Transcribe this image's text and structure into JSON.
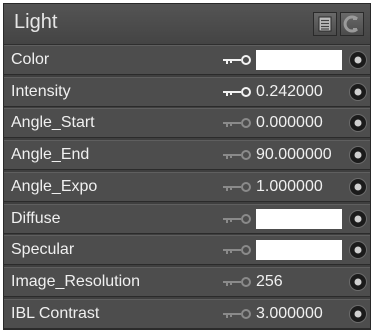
{
  "panel": {
    "title": "Light",
    "buttons": [
      {
        "name": "list-icon"
      },
      {
        "name": "refresh-icon"
      }
    ]
  },
  "rows": [
    {
      "label": "Color",
      "type": "color",
      "color": "#ffffff",
      "key_active": true
    },
    {
      "label": "Intensity",
      "type": "number",
      "value": "0.242000",
      "key_active": true
    },
    {
      "label": "Angle_Start",
      "type": "number",
      "value": "0.000000",
      "key_active": false
    },
    {
      "label": "Angle_End",
      "type": "number",
      "value": "90.000000",
      "key_active": false
    },
    {
      "label": "Angle_Expo",
      "type": "number",
      "value": "1.000000",
      "key_active": false
    },
    {
      "label": "Diffuse",
      "type": "color",
      "color": "#ffffff",
      "key_active": false
    },
    {
      "label": "Specular",
      "type": "color",
      "color": "#ffffff",
      "key_active": false
    },
    {
      "label": "Image_Resolution",
      "type": "number",
      "value": "256",
      "key_active": false
    },
    {
      "label": "IBL Contrast",
      "type": "number",
      "value": "3.000000",
      "key_active": false
    }
  ]
}
